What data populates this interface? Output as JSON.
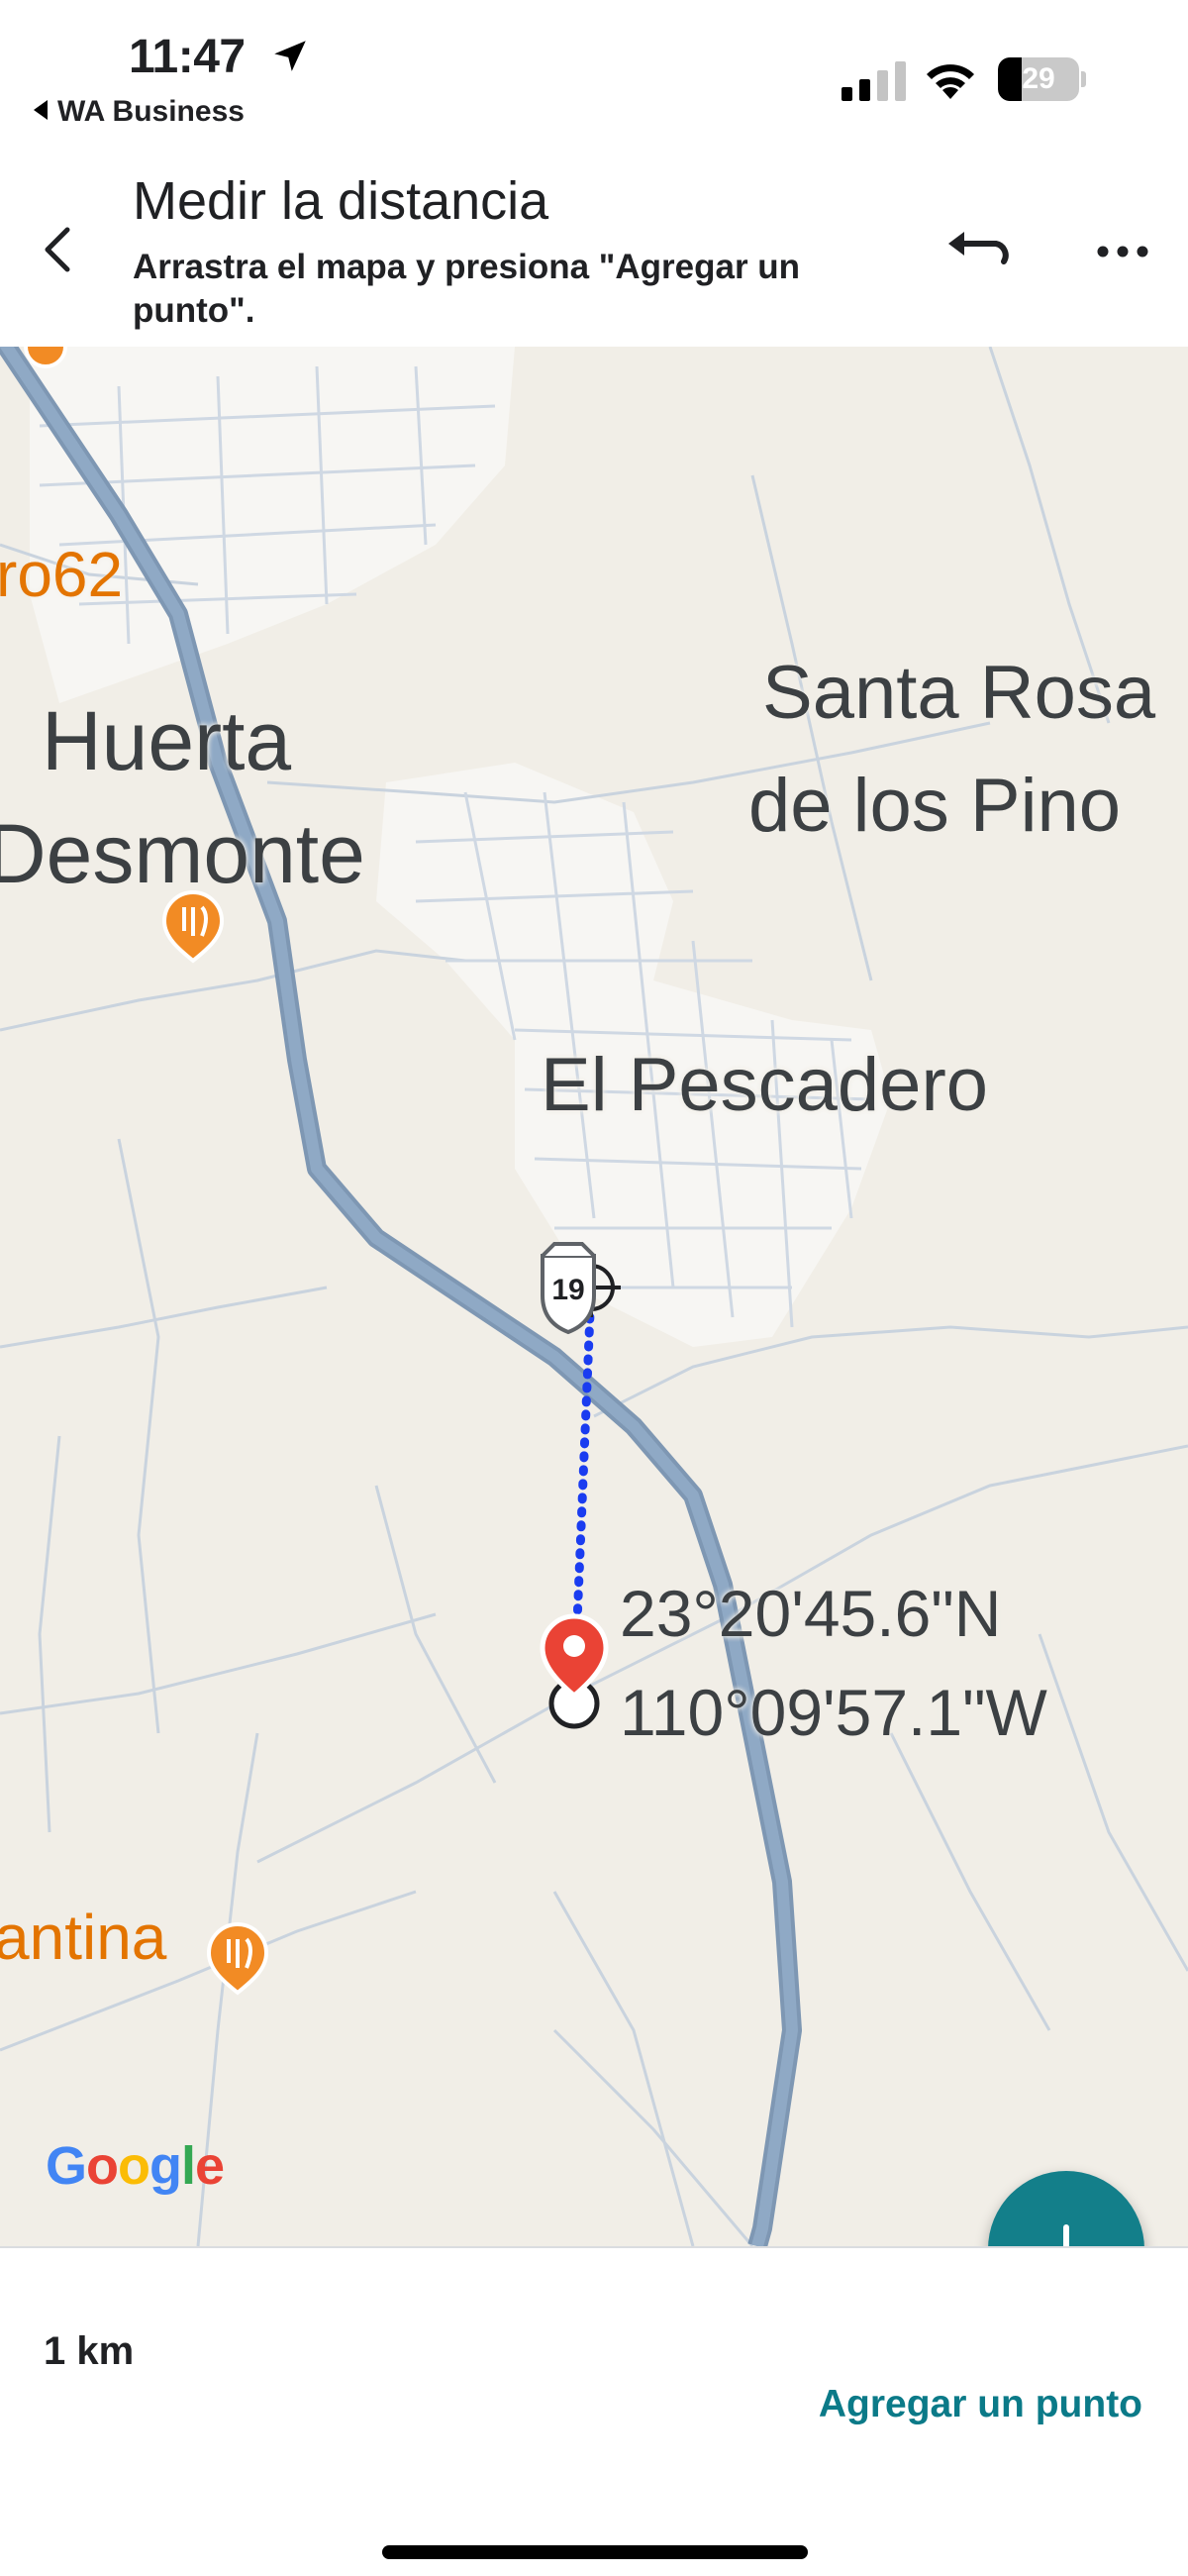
{
  "status_bar": {
    "time": "11:47",
    "back_app": "WA Business",
    "battery": "29",
    "battery_level": 0.29
  },
  "header": {
    "title": "Medir la distancia",
    "subtitle": "Arrastra el mapa y presiona \"Agregar un punto\"."
  },
  "map": {
    "places": [
      {
        "key": "huerta",
        "label": "Huerta"
      },
      {
        "key": "desmonte",
        "label": "Desmonte"
      },
      {
        "key": "santa_rosa",
        "label": "Santa Rosa"
      },
      {
        "key": "de_los_pinos",
        "label": "de los Pino"
      },
      {
        "key": "el_pescadero",
        "label": "El Pescadero"
      }
    ],
    "pois": [
      {
        "label": "ro62",
        "icon": "restaurant-icon"
      },
      {
        "label": "antina",
        "icon": "restaurant-icon"
      }
    ],
    "highway_shield": "19",
    "coordinates": {
      "lat": "23°20'45.6\"N",
      "lon": "110°09'57.1\"W"
    },
    "logo": "Google"
  },
  "bottom_sheet": {
    "distance": "1 km",
    "add_point_label": "Agregar un punto"
  },
  "colors": {
    "accent": "#137f8a",
    "link": "#0b7a88",
    "map_bg": "#f1eee7",
    "highway": "#8aa4c1",
    "measure_line": "#1a3cf0",
    "marker": "#ea4335",
    "poi": "#e37400"
  }
}
